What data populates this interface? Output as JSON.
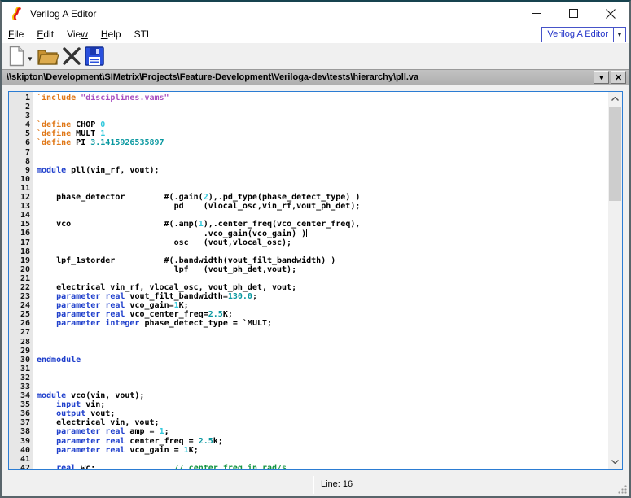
{
  "window": {
    "title": "Verilog A Editor",
    "controls": {
      "minimize": "minimize",
      "maximize": "maximize",
      "close": "close"
    }
  },
  "menu": {
    "items": [
      {
        "label": "File",
        "underline": 0
      },
      {
        "label": "Edit",
        "underline": 0
      },
      {
        "label": "View",
        "underline": 3
      },
      {
        "label": "Help",
        "underline": 0
      },
      {
        "label": "STL",
        "underline": -1
      }
    ],
    "doc_selector": {
      "value": "Verilog A Editor",
      "accent_color": "#4653c8",
      "text_color": "#2232c8"
    }
  },
  "toolbar": {
    "buttons": [
      {
        "icon": "new-document-icon",
        "has_dropdown": true
      },
      {
        "icon": "open-folder-icon"
      },
      {
        "icon": "close-file-icon"
      },
      {
        "icon": "save-icon"
      }
    ]
  },
  "pathbar": {
    "path": "\\\\skipton\\Development\\SIMetrix\\Projects\\Feature-Development\\Veriloga-dev\\tests\\hierarchy\\pll.va",
    "buttons": [
      {
        "icon": "dropdown-arrow-icon",
        "glyph": "▼"
      },
      {
        "icon": "close-tab-icon",
        "glyph": "✕"
      }
    ]
  },
  "editor": {
    "syntax_colors": {
      "keyword": "#2040cc",
      "preprocessor": "#e07818",
      "string": "#aa50c0",
      "number_int": "#30c8dc",
      "number_real": "#0a98a0",
      "comment": "#149440",
      "plain": "#000000"
    },
    "cursor_line": 16,
    "lines": [
      {
        "n": 1,
        "t": [
          [
            "pp",
            "`include"
          ],
          [
            "pl",
            " "
          ],
          [
            "str",
            "\"disciplines.vams\""
          ]
        ]
      },
      {
        "n": 2,
        "t": []
      },
      {
        "n": 3,
        "t": []
      },
      {
        "n": 4,
        "t": [
          [
            "pp",
            "`define"
          ],
          [
            "pl",
            " CHOP "
          ],
          [
            "numc",
            "0"
          ]
        ]
      },
      {
        "n": 5,
        "t": [
          [
            "pp",
            "`define"
          ],
          [
            "pl",
            " MULT "
          ],
          [
            "numc",
            "1"
          ]
        ]
      },
      {
        "n": 6,
        "t": [
          [
            "pp",
            "`define"
          ],
          [
            "pl",
            " PI "
          ],
          [
            "numt",
            "3.1415926535897"
          ]
        ]
      },
      {
        "n": 7,
        "t": []
      },
      {
        "n": 8,
        "t": []
      },
      {
        "n": 9,
        "t": [
          [
            "kw",
            "module"
          ],
          [
            "pl",
            " pll(vin_rf, vout);"
          ]
        ]
      },
      {
        "n": 10,
        "t": []
      },
      {
        "n": 11,
        "t": []
      },
      {
        "n": 12,
        "t": [
          [
            "pl",
            "    phase_detector        #(.gain("
          ],
          [
            "numc",
            "2"
          ],
          [
            "pl",
            "),.pd_type(phase_detect_type) )"
          ]
        ]
      },
      {
        "n": 13,
        "t": [
          [
            "pl",
            "                            pd    (vlocal_osc,vin_rf,vout_ph_det);"
          ]
        ]
      },
      {
        "n": 14,
        "t": []
      },
      {
        "n": 15,
        "t": [
          [
            "pl",
            "    vco                   #(.amp("
          ],
          [
            "numc",
            "1"
          ],
          [
            "pl",
            "),.center_freq(vco_center_freq),"
          ]
        ]
      },
      {
        "n": 16,
        "t": [
          [
            "pl",
            "                                  .vco_gain(vco_gain) )"
          ]
        ],
        "caret": true
      },
      {
        "n": 17,
        "t": [
          [
            "pl",
            "                            osc   (vout,vlocal_osc);"
          ]
        ]
      },
      {
        "n": 18,
        "t": []
      },
      {
        "n": 19,
        "t": [
          [
            "pl",
            "    lpf_1storder          #(.bandwidth(vout_filt_bandwidth) )"
          ]
        ]
      },
      {
        "n": 20,
        "t": [
          [
            "pl",
            "                            lpf   (vout_ph_det,vout);"
          ]
        ]
      },
      {
        "n": 21,
        "t": []
      },
      {
        "n": 22,
        "t": [
          [
            "pl",
            "    electrical vin_rf, vlocal_osc, vout_ph_det, vout;"
          ]
        ]
      },
      {
        "n": 23,
        "t": [
          [
            "pl",
            "    "
          ],
          [
            "kw",
            "parameter"
          ],
          [
            "pl",
            " "
          ],
          [
            "kw",
            "real"
          ],
          [
            "pl",
            " vout_filt_bandwidth="
          ],
          [
            "numt",
            "130.0"
          ],
          [
            "pl",
            ";"
          ]
        ]
      },
      {
        "n": 24,
        "t": [
          [
            "pl",
            "    "
          ],
          [
            "kw",
            "parameter"
          ],
          [
            "pl",
            " "
          ],
          [
            "kw",
            "real"
          ],
          [
            "pl",
            " vco_gain="
          ],
          [
            "numc",
            "1"
          ],
          [
            "pl",
            "K;"
          ]
        ]
      },
      {
        "n": 25,
        "t": [
          [
            "pl",
            "    "
          ],
          [
            "kw",
            "parameter"
          ],
          [
            "pl",
            " "
          ],
          [
            "kw",
            "real"
          ],
          [
            "pl",
            " vco_center_freq="
          ],
          [
            "numt",
            "2.5"
          ],
          [
            "pl",
            "K;"
          ]
        ]
      },
      {
        "n": 26,
        "t": [
          [
            "pl",
            "    "
          ],
          [
            "kw",
            "parameter"
          ],
          [
            "pl",
            " "
          ],
          [
            "kw",
            "integer"
          ],
          [
            "pl",
            " phase_detect_type = `MULT;"
          ]
        ]
      },
      {
        "n": 27,
        "t": []
      },
      {
        "n": 28,
        "t": []
      },
      {
        "n": 29,
        "t": []
      },
      {
        "n": 30,
        "t": [
          [
            "kw",
            "endmodule"
          ]
        ]
      },
      {
        "n": 31,
        "t": []
      },
      {
        "n": 32,
        "t": []
      },
      {
        "n": 33,
        "t": []
      },
      {
        "n": 34,
        "t": [
          [
            "kw",
            "module"
          ],
          [
            "pl",
            " vco(vin, vout);"
          ]
        ]
      },
      {
        "n": 35,
        "t": [
          [
            "pl",
            "    "
          ],
          [
            "kw",
            "input"
          ],
          [
            "pl",
            " vin;"
          ]
        ]
      },
      {
        "n": 36,
        "t": [
          [
            "pl",
            "    "
          ],
          [
            "kw",
            "output"
          ],
          [
            "pl",
            " vout;"
          ]
        ]
      },
      {
        "n": 37,
        "t": [
          [
            "pl",
            "    electrical vin, vout;"
          ]
        ]
      },
      {
        "n": 38,
        "t": [
          [
            "pl",
            "    "
          ],
          [
            "kw",
            "parameter"
          ],
          [
            "pl",
            " "
          ],
          [
            "kw",
            "real"
          ],
          [
            "pl",
            " amp = "
          ],
          [
            "numc",
            "1"
          ],
          [
            "pl",
            ";"
          ]
        ]
      },
      {
        "n": 39,
        "t": [
          [
            "pl",
            "    "
          ],
          [
            "kw",
            "parameter"
          ],
          [
            "pl",
            " "
          ],
          [
            "kw",
            "real"
          ],
          [
            "pl",
            " center_freq = "
          ],
          [
            "numt",
            "2.5"
          ],
          [
            "pl",
            "k;"
          ]
        ]
      },
      {
        "n": 40,
        "t": [
          [
            "pl",
            "    "
          ],
          [
            "kw",
            "parameter"
          ],
          [
            "pl",
            " "
          ],
          [
            "kw",
            "real"
          ],
          [
            "pl",
            " vco_gain = "
          ],
          [
            "numc",
            "1"
          ],
          [
            "pl",
            "K;"
          ]
        ]
      },
      {
        "n": 41,
        "t": []
      },
      {
        "n": 42,
        "t": [
          [
            "pl",
            "    "
          ],
          [
            "kw",
            "real"
          ],
          [
            "pl",
            " wc;                "
          ],
          [
            "com",
            "// center freq in rad/s"
          ]
        ]
      }
    ]
  },
  "statusbar": {
    "line_indicator": "Line: 16"
  }
}
